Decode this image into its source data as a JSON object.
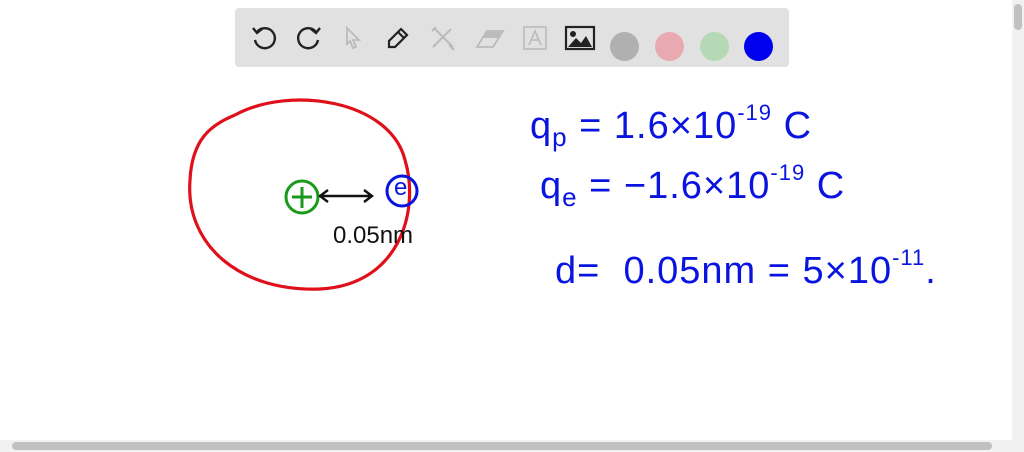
{
  "toolbar": {
    "tools": [
      "undo-icon",
      "redo-icon",
      "select-icon",
      "pen-icon",
      "tools-icon",
      "eraser-icon",
      "text-icon",
      "image-icon"
    ],
    "colors": {
      "gray": "#b0b0b0",
      "pink": "#e8a9b0",
      "green": "#b5d8b5",
      "blue": "#0000ee"
    }
  },
  "diagram": {
    "proton_symbol": "+",
    "electron_symbol": "e",
    "distance_label": "0.05nm",
    "colors": {
      "orbit": "#e0101a",
      "proton": "#1a9a1a",
      "electron": "#0a14e0"
    }
  },
  "equations": {
    "qp": {
      "var": "q",
      "sub": "p",
      "rhs": "= 1.6×10",
      "exp": "-19",
      "unit": " C"
    },
    "qe": {
      "var": "q",
      "sub": "e",
      "rhs": "= −1.6×10",
      "exp": "-19",
      "unit": " C"
    },
    "d": {
      "var": "d",
      "rhs": "=  0.05nm = 5×10",
      "exp": "-11",
      "unit": "."
    }
  }
}
